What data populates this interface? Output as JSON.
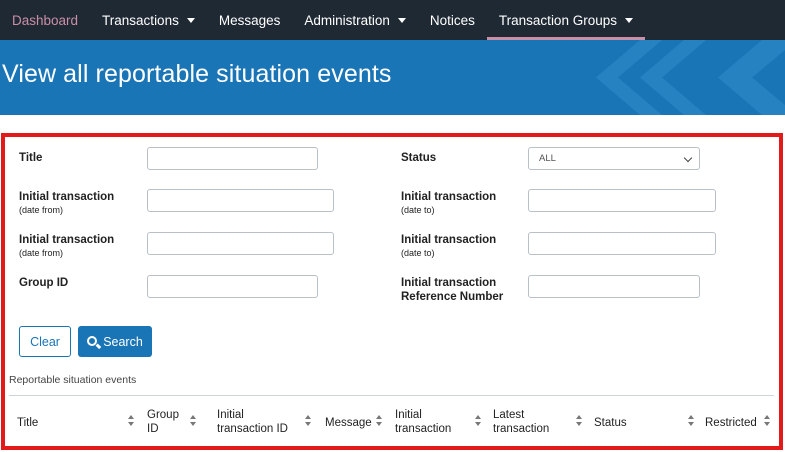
{
  "nav": {
    "items": [
      {
        "label": "Dashboard",
        "has_caret": false
      },
      {
        "label": "Transactions",
        "has_caret": true
      },
      {
        "label": "Messages",
        "has_caret": false
      },
      {
        "label": "Administration",
        "has_caret": true
      },
      {
        "label": "Notices",
        "has_caret": false
      },
      {
        "label": "Transaction Groups",
        "has_caret": true
      }
    ],
    "active_item": "Transaction Groups"
  },
  "banner": {
    "title": "View all reportable situation events"
  },
  "filters": {
    "title_label": "Title",
    "status_label": "Status",
    "status_selected": "ALL",
    "initial_from_label": "Initial transaction",
    "initial_from_sub": "(date from)",
    "initial_to_label": "Initial transaction",
    "initial_to_sub": "(date to)",
    "initial_from2_label": "Initial transaction",
    "initial_from2_sub": "(date from)",
    "initial_to2_label": "Initial transaction",
    "initial_to2_sub": "(date to)",
    "group_id_label": "Group ID",
    "ref_label_line1": "Initial transaction",
    "ref_label_line2": "Reference Number"
  },
  "actions": {
    "clear_label": "Clear",
    "search_label": "Search"
  },
  "table": {
    "caption": "Reportable situation events",
    "columns": [
      {
        "l1": "Title",
        "l2": ""
      },
      {
        "l1": "Group",
        "l2": "ID"
      },
      {
        "l1": "Initial",
        "l2": "transaction ID"
      },
      {
        "l1": "Message",
        "l2": ""
      },
      {
        "l1": "Initial",
        "l2": "transaction"
      },
      {
        "l1": "Latest",
        "l2": "transaction"
      },
      {
        "l1": "Status",
        "l2": ""
      },
      {
        "l1": "Restricted",
        "l2": ""
      }
    ]
  },
  "colors": {
    "nav_bg": "#1f2933",
    "accent": "#c98fa6",
    "brand_blue": "#1a75b6",
    "highlight_border": "#e31a1a"
  }
}
